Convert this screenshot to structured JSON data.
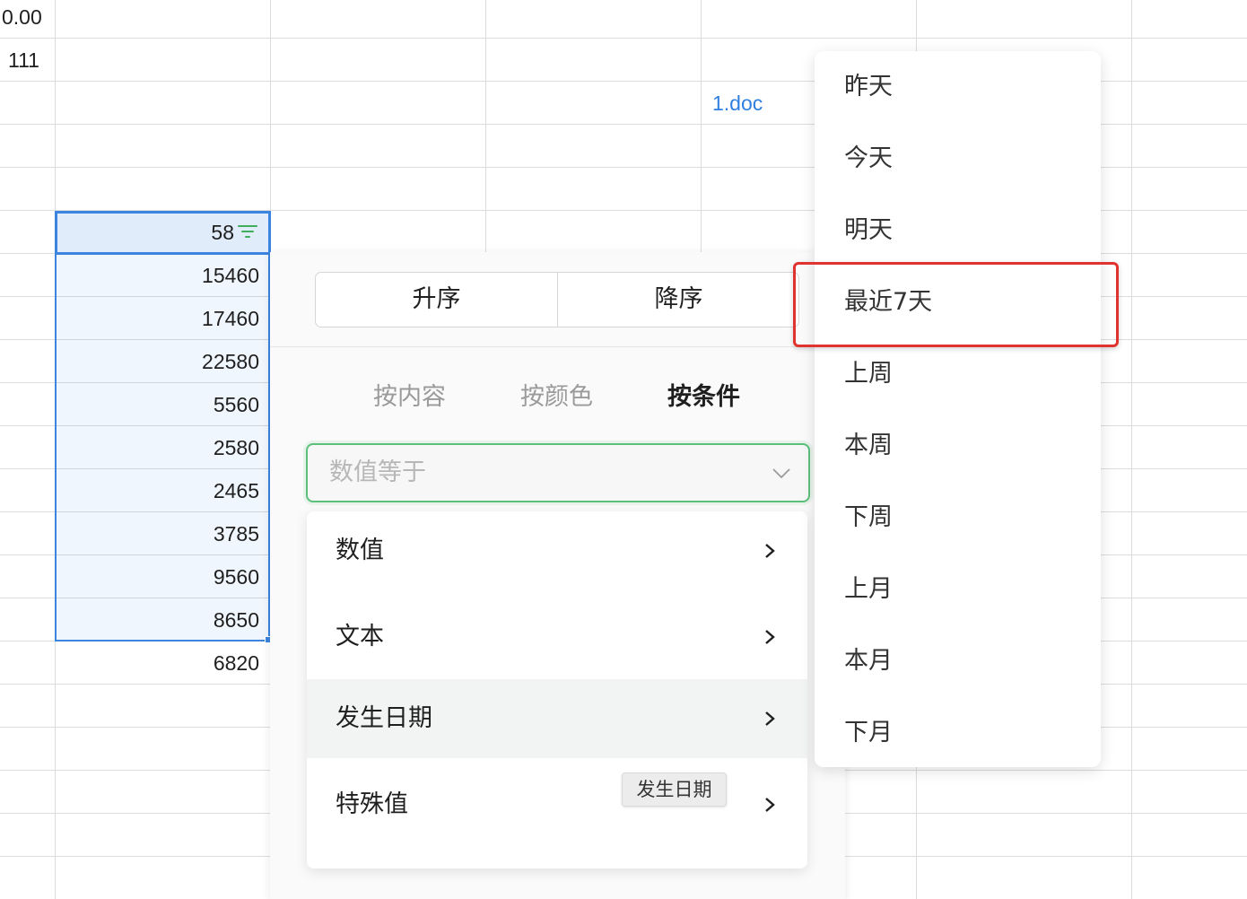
{
  "sheet": {
    "top_cells": {
      "a1": "0.00",
      "a2": "111",
      "attachment_link": "1.doc"
    },
    "column_b_values": [
      "58",
      "15460",
      "17460",
      "22580",
      "5560",
      "2580",
      "2465",
      "3785",
      "9560",
      "8650",
      "6820"
    ]
  },
  "filter_panel": {
    "sort": {
      "ascending": "升序",
      "descending": "降序"
    },
    "tabs": [
      "按内容",
      "按颜色",
      "按条件"
    ],
    "active_tab": "按条件",
    "condition_select": {
      "placeholder": "数值等于"
    },
    "condition_types": [
      {
        "label": "数值"
      },
      {
        "label": "文本"
      },
      {
        "label": "发生日期"
      },
      {
        "label": "特殊值"
      }
    ],
    "hovered_type": "发生日期",
    "tooltip": "发生日期"
  },
  "date_submenu": {
    "items": [
      "昨天",
      "今天",
      "明天",
      "最近7天",
      "上周",
      "本周",
      "下周",
      "上月",
      "本月",
      "下月"
    ],
    "highlighted": "最近7天"
  },
  "colors": {
    "selection_border": "#3b84e0",
    "select_focus_border": "#5cc07b",
    "filter_icon": "#3fae5c",
    "link": "#2f7fe0",
    "highlight_box": "#e0332f"
  }
}
